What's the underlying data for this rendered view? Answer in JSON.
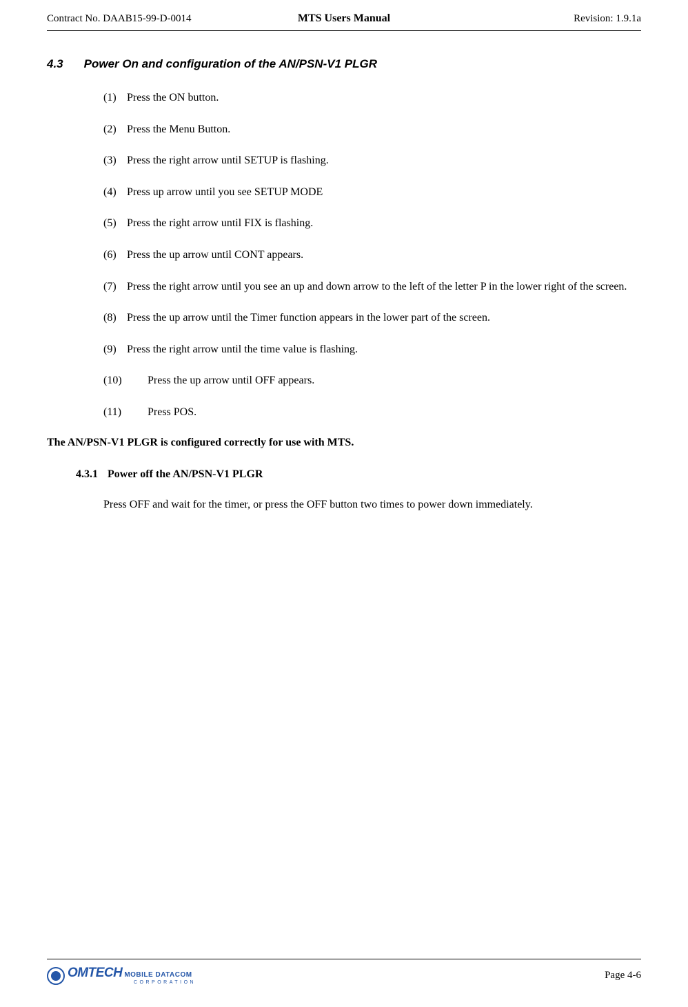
{
  "header": {
    "left": "Contract No. DAAB15-99-D-0014",
    "center": "MTS Users Manual",
    "right": "Revision:  1.9.1a"
  },
  "section": {
    "number": "4.3",
    "title": "Power On and configuration of the AN/PSN-V1 PLGR"
  },
  "steps": [
    {
      "num": "(1)",
      "text": "Press the ON button."
    },
    {
      "num": "(2)",
      "text": "Press the Menu Button."
    },
    {
      "num": "(3)",
      "text": "Press the right arrow until SETUP is flashing."
    },
    {
      "num": "(4)",
      "text": "Press up arrow until you see SETUP MODE"
    },
    {
      "num": "(5)",
      "text": "Press the right arrow until FIX is flashing."
    },
    {
      "num": "(6)",
      "text": "Press the up arrow until CONT appears."
    },
    {
      "num": "(7)",
      "text": "Press the right arrow until you see an up and down arrow to the left of the letter P in the lower right of the screen."
    },
    {
      "num": "(8)",
      "text": "Press the up arrow until the Timer function appears in the lower part of the screen."
    },
    {
      "num": "(9)",
      "text": "Press the right arrow until the time value is flashing."
    },
    {
      "num": "(10)",
      "text": "Press the up arrow until OFF appears."
    },
    {
      "num": "(11)",
      "text": "Press POS."
    }
  ],
  "config_statement": "The AN/PSN-V1 PLGR is configured correctly for use with MTS.",
  "subsection": {
    "number": "4.3.1",
    "title": "Power off the AN/PSN-V1 PLGR",
    "body": "Press OFF and wait for the timer, or press the OFF button two times to power down immediately."
  },
  "footer": {
    "logo_omtech": "OMTECH",
    "logo_mobile": "MOBILE DATACOM",
    "logo_corp": "CORPORATION",
    "page": "Page 4-6"
  }
}
